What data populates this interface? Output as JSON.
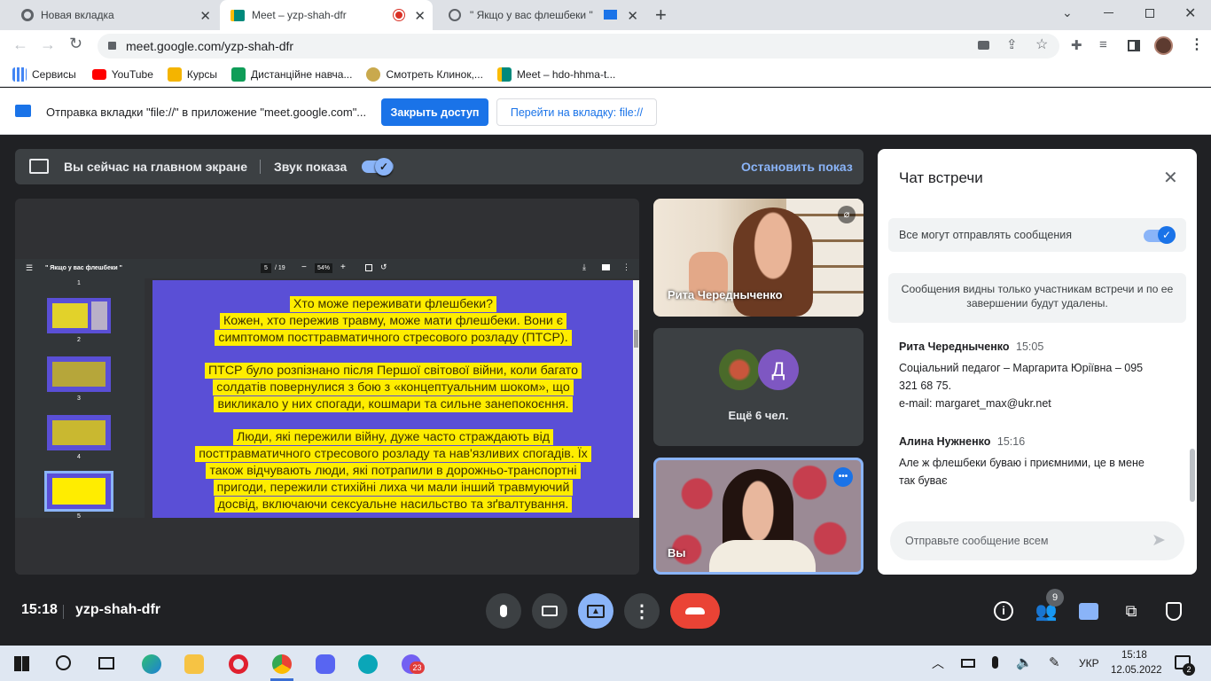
{
  "browser": {
    "tabs": [
      {
        "label": "Новая вкладка"
      },
      {
        "label": "Meet – yzp-shah-dfr"
      },
      {
        "label": "\" Якщо у вас флешбеки \""
      }
    ],
    "url": "meet.google.com/yzp-shah-dfr",
    "bookmarks": [
      {
        "label": "Сервисы",
        "color": "#4285f4"
      },
      {
        "label": "YouTube",
        "color": "#ff0000"
      },
      {
        "label": "Курсы",
        "color": "#f4b400"
      },
      {
        "label": "Дистанційне навча...",
        "color": "#0f9d58"
      },
      {
        "label": "Смотреть Клинок,...",
        "color": "#c9a94d"
      },
      {
        "label": "Meet – hdo-hhma-t...",
        "color": "#00897b"
      }
    ],
    "infobar": {
      "message": "Отправка вкладки \"file://\" в приложение \"meet.google.com\"...",
      "stop_label": "Закрыть доступ",
      "switch_label": "Перейти на вкладку: file://"
    }
  },
  "presenting": {
    "message": "Вы сейчас на главном экране",
    "audio_label": "Звук показа",
    "stop_label": "Остановить показ"
  },
  "pdf": {
    "title": "\" Якщо у вас флешбеки \"",
    "page": "5",
    "pages": "/ 19",
    "zoom": "54%",
    "thumb_numbers": [
      "1",
      "2",
      "3",
      "4",
      "5"
    ],
    "slide_lines": [
      "Хто може переживати флешбеки?",
      "Кожен, хто пережив травму, може мати флешбеки. Вони є",
      "симптомом посттравматичного стресового розладу (ПТСР).",
      "",
      "ПТСР було розпізнано після Першої світової війни, коли багато",
      "солдатів повернулися з бою з «концептуальним шоком», що",
      "викликало у них спогади, кошмари та сильне занепокоєння.",
      "",
      "Люди, які пережили війну, дуже часто страждають від",
      "посттравматичного стресового розладу та нав'язливих спогадів. Їх",
      "також відчувають люди, які потрапили в дорожньо-транспортні",
      "пригоди, пережили стихійні лиха чи мали інший травмуючий",
      "досвід, включаючи сексуальне насильство та зґвалтування."
    ]
  },
  "participants": {
    "rita_name": "Рита Чередныченко",
    "more_avatar": "Д",
    "more_label": "Ещё 6 чел.",
    "self_label": "Вы"
  },
  "chat": {
    "title": "Чат встречи",
    "toggle_label": "Все могут отправлять сообщения",
    "notice": "Сообщения видны только участникам встречи и по ее завершении будут удалены.",
    "messages": [
      {
        "author": "Рита Чередныченко",
        "time": "15:05",
        "lines": [
          "Соціальний педагог – Маргарита Юріївна – 095",
          "321 68 75.",
          "e-mail: margaret_max@ukr.net"
        ]
      },
      {
        "author": "Алина Нужненко",
        "time": "15:16",
        "lines": [
          "Але ж флешбеки буваю і приємними, це в мене",
          "так буває"
        ]
      }
    ],
    "input_placeholder": "Отправьте сообщение всем"
  },
  "footer": {
    "time": "15:18",
    "meeting_code": "yzp-shah-dfr",
    "participants_badge": "9"
  },
  "taskbar": {
    "lang": "УКР",
    "time": "15:18",
    "date": "12.05.2022",
    "notif_count": "2",
    "viber_badge": "23"
  },
  "colors": {
    "accent": "#8ab4f8",
    "slide_bg": "#5a4fd6",
    "slide_text_bg": "#ffed00",
    "end_call": "#ea4335",
    "blue_button": "#1a73e8"
  }
}
